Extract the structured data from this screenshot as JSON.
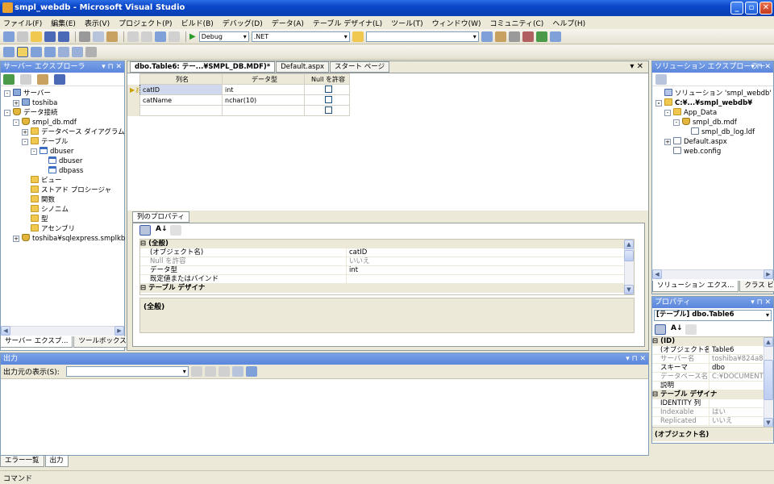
{
  "window": {
    "title": "smpl_webdb - Microsoft Visual Studio"
  },
  "menu": [
    "ファイル(F)",
    "編集(E)",
    "表示(V)",
    "プロジェクト(P)",
    "ビルド(B)",
    "デバッグ(D)",
    "データ(A)",
    "テーブル デザイナ(L)",
    "ツール(T)",
    "ウィンドウ(W)",
    "コミュニティ(C)",
    "ヘルプ(H)"
  ],
  "toolbar": {
    "config": "Debug",
    "platform": ".NET",
    "search": ""
  },
  "server_explorer": {
    "title": "サーバー エクスプローラ",
    "tree": [
      {
        "label": "サーバー",
        "indent": 0,
        "icon": "server",
        "exp": "-"
      },
      {
        "label": "toshiba",
        "indent": 1,
        "icon": "server",
        "exp": "+"
      },
      {
        "label": "データ接続",
        "indent": 0,
        "icon": "db",
        "exp": "-"
      },
      {
        "label": "smpl_db.mdf",
        "indent": 1,
        "icon": "db",
        "exp": "-"
      },
      {
        "label": "データベース ダイアグラム",
        "indent": 2,
        "icon": "folder",
        "exp": "+"
      },
      {
        "label": "テーブル",
        "indent": 2,
        "icon": "folder",
        "exp": "-"
      },
      {
        "label": "dbuser",
        "indent": 3,
        "icon": "table",
        "exp": "-"
      },
      {
        "label": "dbuser",
        "indent": 4,
        "icon": "table",
        "exp": ""
      },
      {
        "label": "dbpass",
        "indent": 4,
        "icon": "table",
        "exp": ""
      },
      {
        "label": "ビュー",
        "indent": 2,
        "icon": "folder",
        "exp": ""
      },
      {
        "label": "ストアド プロシージャ",
        "indent": 2,
        "icon": "folder",
        "exp": ""
      },
      {
        "label": "関数",
        "indent": 2,
        "icon": "folder",
        "exp": ""
      },
      {
        "label": "シノニム",
        "indent": 2,
        "icon": "folder",
        "exp": ""
      },
      {
        "label": "型",
        "indent": 2,
        "icon": "folder",
        "exp": ""
      },
      {
        "label": "アセンブリ",
        "indent": 2,
        "icon": "folder",
        "exp": ""
      },
      {
        "label": "toshiba¥sqlexpress.smplkb",
        "indent": 1,
        "icon": "db",
        "exp": "+"
      }
    ],
    "tabs": [
      "サーバー エクスプ...",
      "ツールボックス"
    ]
  },
  "editor": {
    "tabs": [
      "dbo.Table6: テー...¥SMPL_DB.MDF)*",
      "Default.aspx",
      "スタート ページ"
    ],
    "columns": [
      "列名",
      "データ型",
      "Null を許容"
    ],
    "rows": [
      {
        "name": "catID",
        "type": "int",
        "nullable": false
      },
      {
        "name": "catName",
        "type": "nchar(10)",
        "nullable": false
      },
      {
        "name": "",
        "type": "",
        "nullable": false
      }
    ]
  },
  "column_props": {
    "tab": "列のプロパティ",
    "cat1": "(全般)",
    "rows": [
      {
        "k": "(オブジェクト名)",
        "v": "catID",
        "dim": false
      },
      {
        "k": "Null を許容",
        "v": "いいえ",
        "dim": true
      },
      {
        "k": "データ型",
        "v": "int",
        "dim": false
      },
      {
        "k": "既定値またはバインド",
        "v": "",
        "dim": false
      }
    ],
    "cat2": "テーブル デザイナ",
    "footer": "(全般)"
  },
  "solution_explorer": {
    "title": "ソリューション エクスプローラー",
    "tree": [
      {
        "label": "ソリューション 'smpl_webdb' (1 プロジ",
        "indent": 0,
        "icon": "sln",
        "exp": ""
      },
      {
        "label": "C:¥...¥smpl_webdb¥",
        "indent": 0,
        "icon": "folder",
        "exp": "-",
        "bold": true
      },
      {
        "label": "App_Data",
        "indent": 1,
        "icon": "folder",
        "exp": "-"
      },
      {
        "label": "smpl_db.mdf",
        "indent": 2,
        "icon": "db",
        "exp": "-"
      },
      {
        "label": "smpl_db_log.ldf",
        "indent": 3,
        "icon": "file",
        "exp": ""
      },
      {
        "label": "Default.aspx",
        "indent": 1,
        "icon": "file",
        "exp": "+"
      },
      {
        "label": "web.config",
        "indent": 1,
        "icon": "file",
        "exp": ""
      }
    ],
    "tabs": [
      "ソリューション エクス...",
      "クラス ビュー"
    ]
  },
  "properties": {
    "title": "プロパティ",
    "selector": "[テーブル] dbo.Table6",
    "rows": [
      {
        "cat": true,
        "k": "(ID)",
        "v": ""
      },
      {
        "k": "(オブジェクト名)",
        "v": "Table6",
        "dim": false
      },
      {
        "k": "サーバー名",
        "v": "toshiba¥824a875",
        "dim": true
      },
      {
        "k": "スキーマ",
        "v": "dbo",
        "dim": false
      },
      {
        "k": "データベース名",
        "v": "C:¥DOCUMENTS",
        "dim": true
      },
      {
        "k": "説明",
        "v": "",
        "dim": false
      },
      {
        "cat": true,
        "k": "テーブル デザイナ",
        "v": ""
      },
      {
        "k": "IDENTITY 列",
        "v": "",
        "dim": false
      },
      {
        "k": "Indexable",
        "v": "はい",
        "dim": true
      },
      {
        "k": "Replicated",
        "v": "いいえ",
        "dim": true
      }
    ],
    "footer": "(オブジェクト名)"
  },
  "output": {
    "title": "出力",
    "source_label": "出力元の表示(S):",
    "tabs": [
      "エラー一覧",
      "出力"
    ]
  },
  "status": "コマンド"
}
